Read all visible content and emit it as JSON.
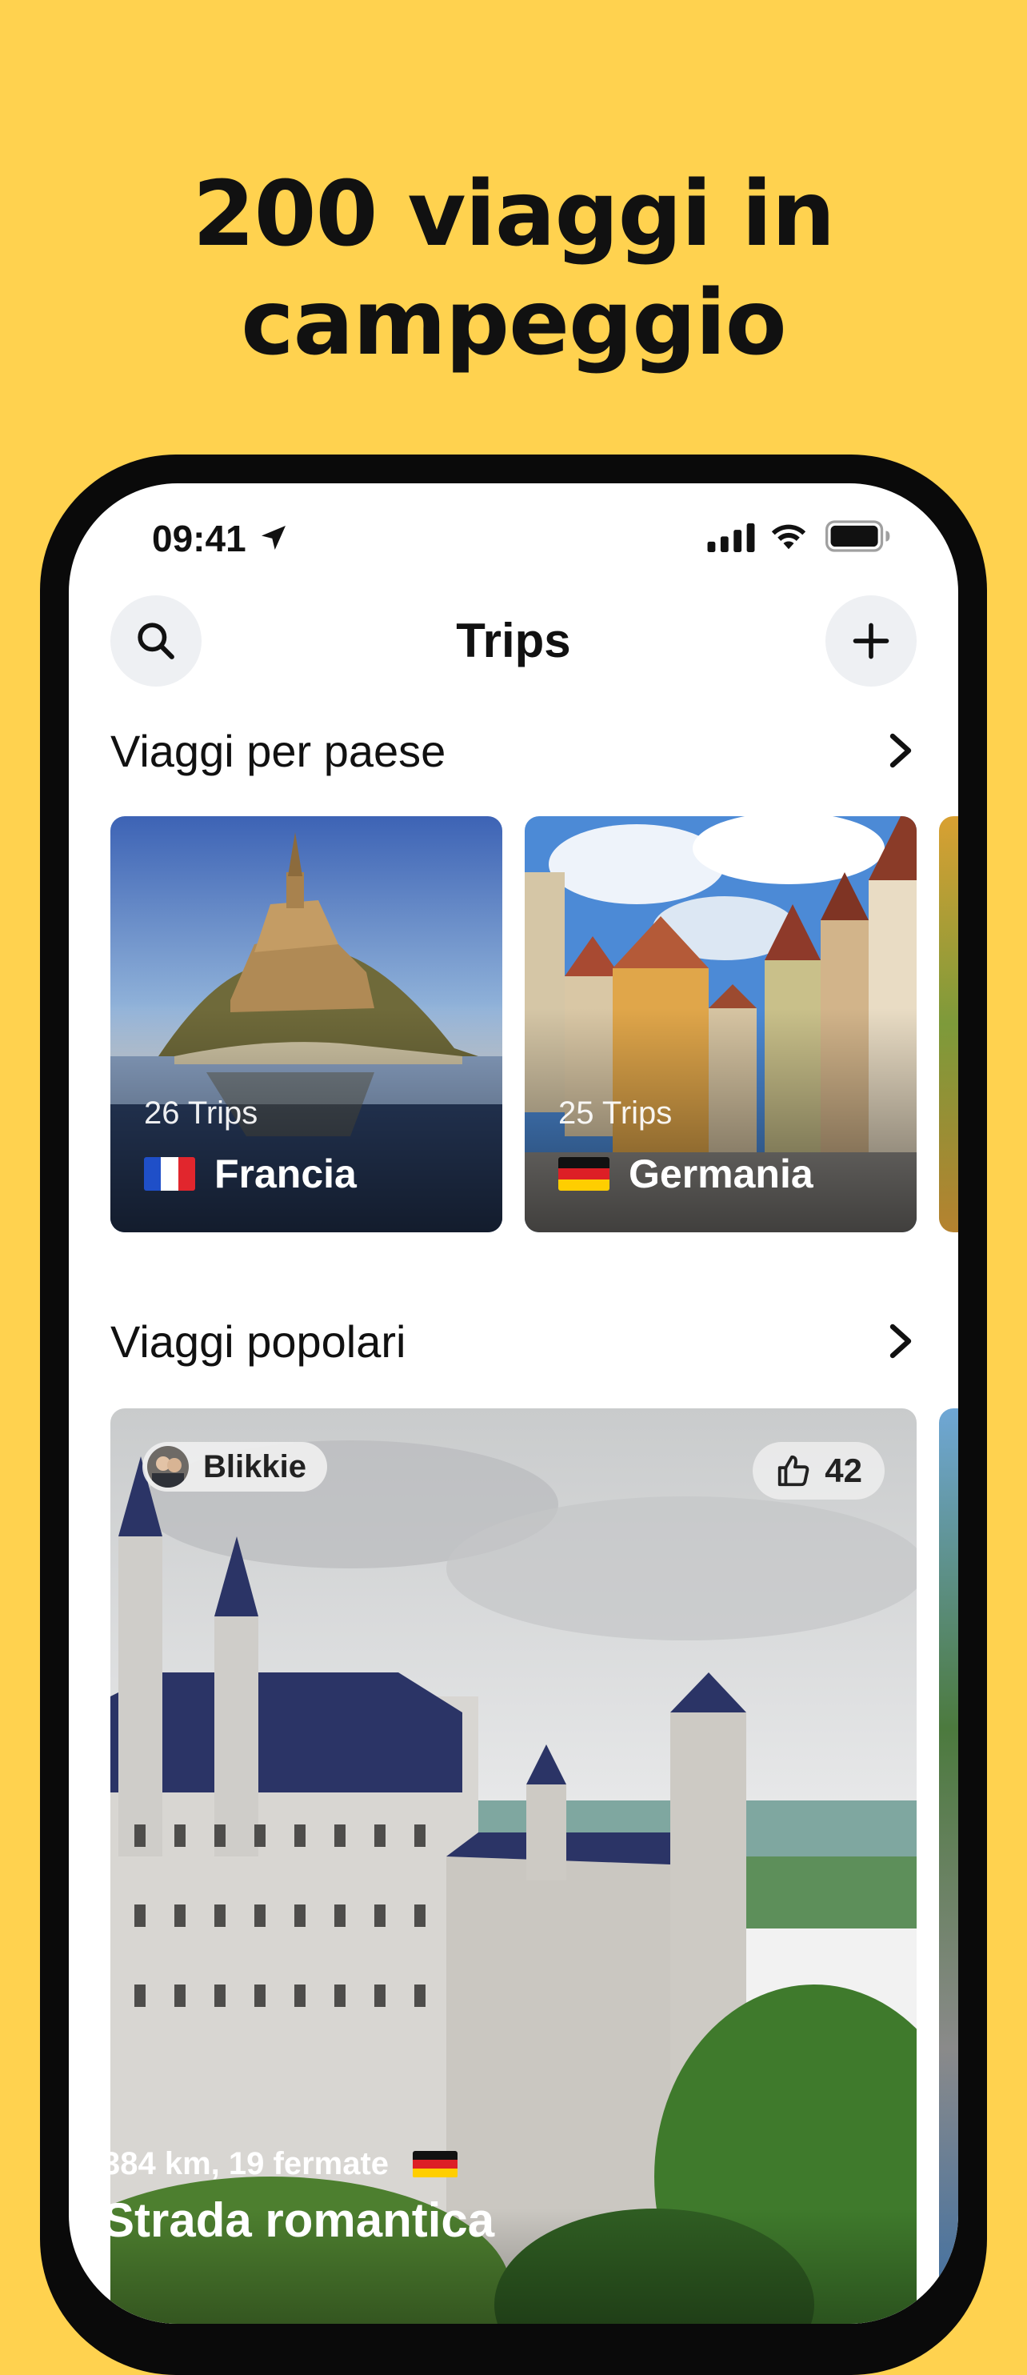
{
  "headline": {
    "line1": "200 viaggi in",
    "line2": "campeggio"
  },
  "status_bar": {
    "time": "09:41"
  },
  "nav": {
    "title": "Trips"
  },
  "sections": {
    "by_country": {
      "title": "Viaggi per paese",
      "cards": [
        {
          "trips": "26 Trips",
          "name": "Francia",
          "flag": "fr"
        },
        {
          "trips": "25 Trips",
          "name": "Germania",
          "flag": "de"
        }
      ]
    },
    "popular": {
      "title": "Viaggi popolari",
      "card": {
        "author": "Blikkie",
        "likes": "42",
        "meta": "384 km, 19 fermate",
        "name": "Strada romantica",
        "flag": "de"
      }
    }
  },
  "colors": {
    "background": "#FFD24F",
    "phone_frame": "#0a0a0a",
    "screen": "#ffffff"
  }
}
